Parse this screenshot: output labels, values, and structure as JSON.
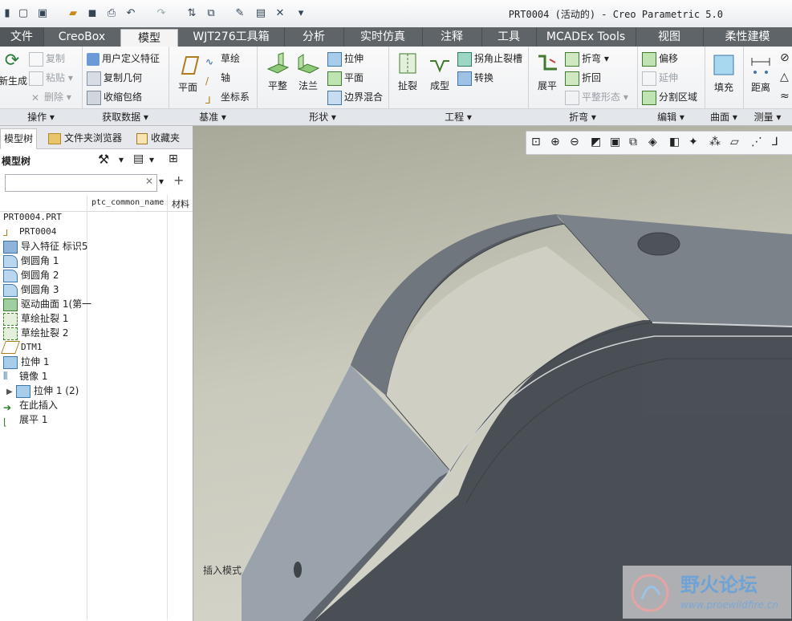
{
  "window": {
    "title": "PRT0004 (活动的) - Creo Parametric 5.0"
  },
  "tabs": [
    {
      "label": "文件"
    },
    {
      "label": "CreoBox"
    },
    {
      "label": "模型"
    },
    {
      "label": "WJT276工具箱"
    },
    {
      "label": "分析"
    },
    {
      "label": "实时仿真"
    },
    {
      "label": "注释"
    },
    {
      "label": "工具"
    },
    {
      "label": "MCADEx Tools"
    },
    {
      "label": "视图"
    },
    {
      "label": "柔性建模"
    }
  ],
  "ribbon": {
    "ops": {
      "label": "操作",
      "regen": "新生成",
      "copy": "复制",
      "paste": "粘贴",
      "delete": "删除"
    },
    "getdata": {
      "label": "获取数据",
      "udf": "用户定义特征",
      "copygeom": "复制几何",
      "shrink": "收缩包络"
    },
    "datum": {
      "label": "基准",
      "plane": "平面",
      "sketch": "草绘",
      "axis": "轴",
      "csys": "坐标系"
    },
    "shapes": {
      "label": "形状",
      "flat": "平整",
      "flange": "法兰",
      "extrude": "拉伸",
      "planar": "平面",
      "blend": "边界混合"
    },
    "eng": {
      "label": "工程",
      "rip": "扯裂",
      "form": "成型",
      "corner": "拐角止裂槽",
      "convert": "转换"
    },
    "bend": {
      "label": "折弯",
      "unbend": "展平",
      "bendit": "折弯",
      "bendback": "折回",
      "flatform": "平整形态"
    },
    "edit": {
      "label": "编辑",
      "offset": "偏移",
      "extend": "延伸",
      "split": "分割区域"
    },
    "surface": {
      "label": "曲面",
      "fill": "填充"
    },
    "measure": {
      "label": "测量",
      "distance": "距离"
    }
  },
  "panel": {
    "tabs": [
      "模型树",
      "文件夹浏览器",
      "收藏夹"
    ],
    "tree_title": "模型树",
    "columns": [
      "ptc_common_name",
      "材料"
    ],
    "tree": [
      "PRT0004.PRT",
      "PRT0004",
      "导入特征 标识5",
      "倒圆角 1",
      "倒圆角 2",
      "倒圆角 3",
      "驱动曲面 1(第一",
      "草绘扯裂 1",
      "草绘扯裂 2",
      "DTM1",
      "拉伸 1",
      "镜像 1",
      "拉伸 1 (2)",
      "在此插入",
      "展平 1"
    ]
  },
  "viewport": {
    "mode": "插入模式"
  },
  "watermark": {
    "title": "野火论坛",
    "url": "www.proewildfire.cn"
  },
  "colors": {
    "tabbar": "#5f6469",
    "part_dark": "#4b5056",
    "part_mid": "#6d7379",
    "part_light": "#9aa3ab"
  }
}
